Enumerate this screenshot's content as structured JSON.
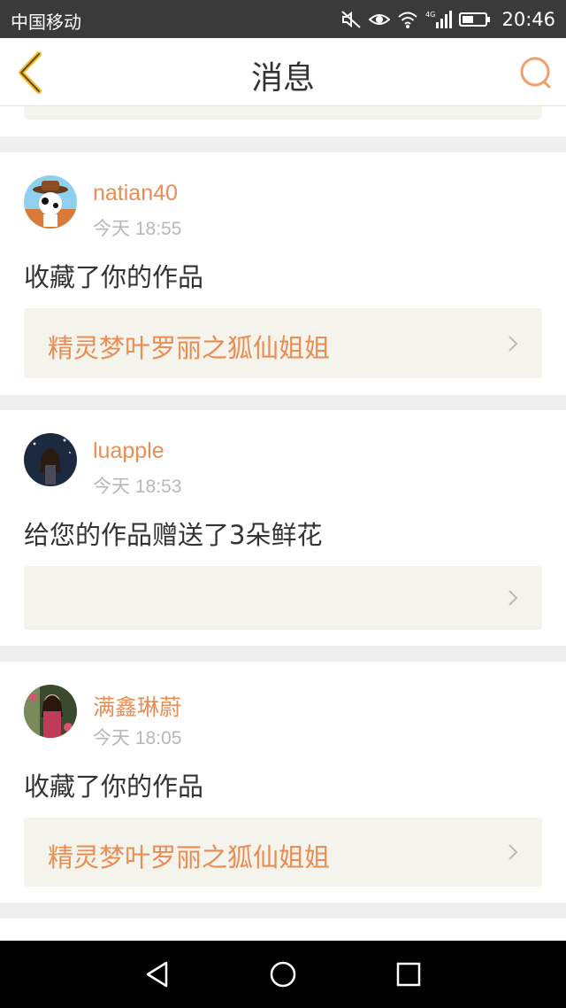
{
  "status_bar": {
    "carrier": "中国移动",
    "time": "20:46",
    "network": "4G",
    "icons": [
      "mute-icon",
      "eye-icon",
      "wifi-icon",
      "signal-icon",
      "battery-icon"
    ]
  },
  "header": {
    "title": "消息",
    "back_icon": "back-chevron-icon",
    "search_icon": "search-icon"
  },
  "messages": [
    {
      "username": "natian40",
      "time": "今天 18:55",
      "action": "收藏了你的作品",
      "work_title": "精灵梦叶罗丽之狐仙姐姐"
    },
    {
      "username": "luapple",
      "time": "今天 18:53",
      "action": "给您的作品赠送了3朵鲜花",
      "work_title": ""
    },
    {
      "username": "满鑫琳蔚",
      "time": "今天 18:05",
      "action": "收藏了你的作品",
      "work_title": "精灵梦叶罗丽之狐仙姐姐"
    }
  ],
  "system_nav": {
    "icons": [
      "back-triangle-icon",
      "home-circle-icon",
      "recents-square-icon"
    ]
  },
  "colors": {
    "accent": "#e98d54",
    "card_inner": "#f4f3ec",
    "background": "#efefef"
  }
}
